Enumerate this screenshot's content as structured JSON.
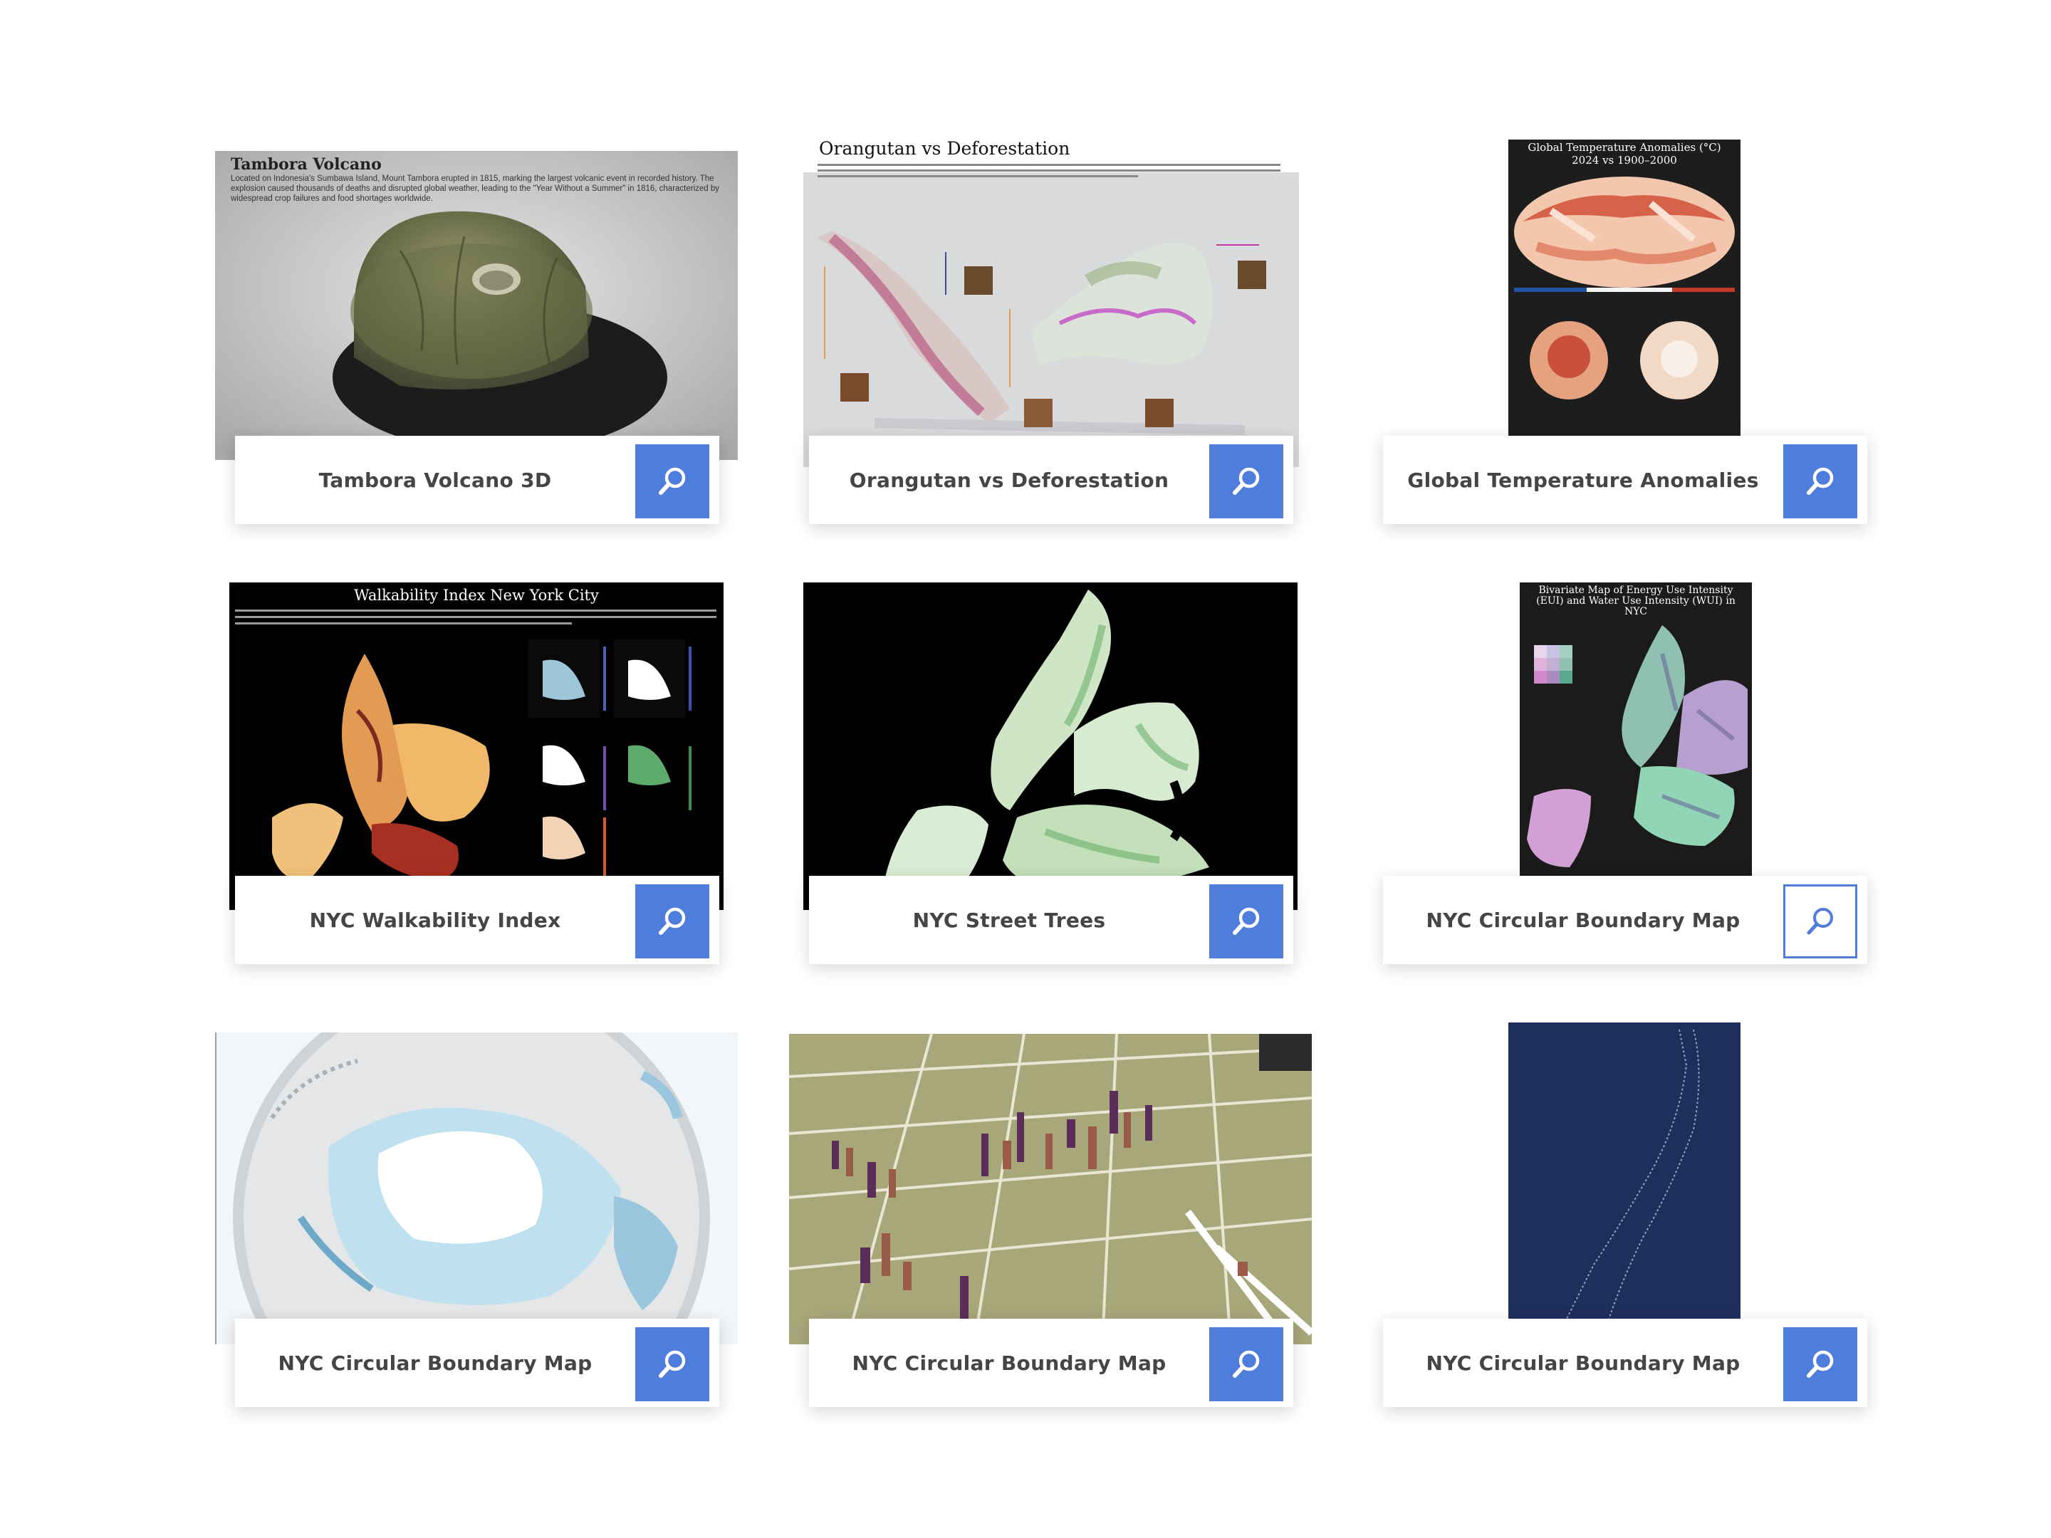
{
  "gallery": {
    "items": [
      {
        "caption": "Tambora Volcano 3D",
        "thumb_title": "Tambora Volcano",
        "thumb_desc": "Located on Indonesia's Sumbawa Island, Mount Tambora erupted in 1815, marking the largest volcanic event in recorded history. The explosion caused thousands of deaths and disrupted global weather, leading to the \"Year Without a Summer\" in 1816, characterized by widespread crop failures and food shortages worldwide."
      },
      {
        "caption": "Orangutan vs Deforestation",
        "thumb_title": "Orangutan vs Deforestation"
      },
      {
        "caption": "Global Temperature Anomalies",
        "thumb_title": "Global Temperature Anomalies (°C)",
        "thumb_subtitle": "2024 vs 1900–2000"
      },
      {
        "caption": "NYC Walkability Index",
        "thumb_title": "Walkability Index New York City"
      },
      {
        "caption": "NYC Street Trees"
      },
      {
        "caption": "NYC Circular Boundary Map",
        "thumb_title": "Bivariate Map of Energy Use Intensity (EUI) and Water Use Intensity (WUI) in NYC"
      },
      {
        "caption": "NYC Circular Boundary Map"
      },
      {
        "caption": "NYC Circular Boundary Map"
      },
      {
        "caption": "NYC Circular Boundary Map"
      }
    ]
  },
  "colors": {
    "accent": "#4f7ddb",
    "caption_text": "#454545"
  },
  "icons": {
    "zoom": "magnifier-icon"
  }
}
